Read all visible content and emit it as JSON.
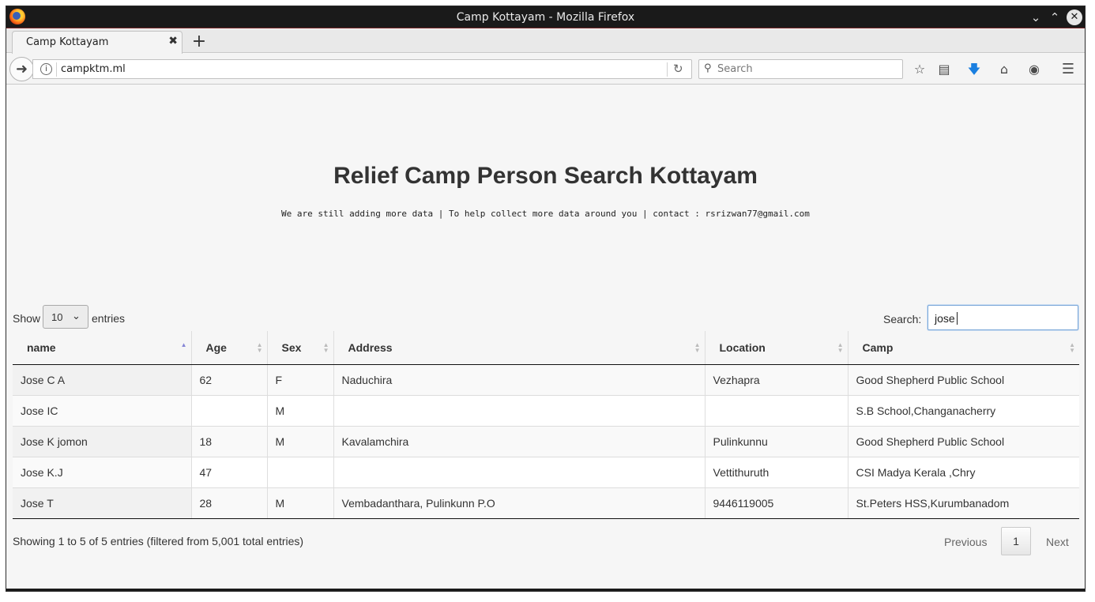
{
  "window": {
    "title": "Camp Kottayam - Mozilla Firefox"
  },
  "tab": {
    "label": "Camp Kottayam"
  },
  "navbar": {
    "url": "campktm.ml",
    "search_placeholder": "Search"
  },
  "page": {
    "title": "Relief Camp Person Search Kottayam",
    "subtitle": "We are still adding more data | To help collect more data around you | contact : rsrizwan77@gmail.com"
  },
  "controls": {
    "show_label": "Show",
    "entries_value": "10",
    "entries_label": "entries",
    "search_label": "Search:",
    "search_value": "jose"
  },
  "table": {
    "columns": [
      "name",
      "Age",
      "Sex",
      "Address",
      "Location",
      "Camp"
    ],
    "rows": [
      [
        "Jose C A",
        "62",
        "F",
        "Naduchira",
        "Vezhapra",
        "Good Shepherd Public School"
      ],
      [
        "Jose IC",
        "",
        "M",
        "",
        "",
        "S.B School,Changanacherry"
      ],
      [
        "Jose K jomon",
        "18",
        "M",
        "Kavalamchira",
        "Pulinkunnu",
        "Good Shepherd Public School"
      ],
      [
        "Jose K.J",
        "47",
        "",
        "",
        "Vettithuruth",
        "CSI Madya Kerala ,Chry"
      ],
      [
        "Jose T",
        "28",
        "M",
        "Vembadanthara, Pulinkunn P.O",
        "9446119005",
        "St.Peters HSS,Kurumbanadom"
      ]
    ]
  },
  "footer": {
    "info": "Showing 1 to 5 of 5 entries (filtered from 5,001 total entries)",
    "previous": "Previous",
    "page": "1",
    "next": "Next"
  }
}
